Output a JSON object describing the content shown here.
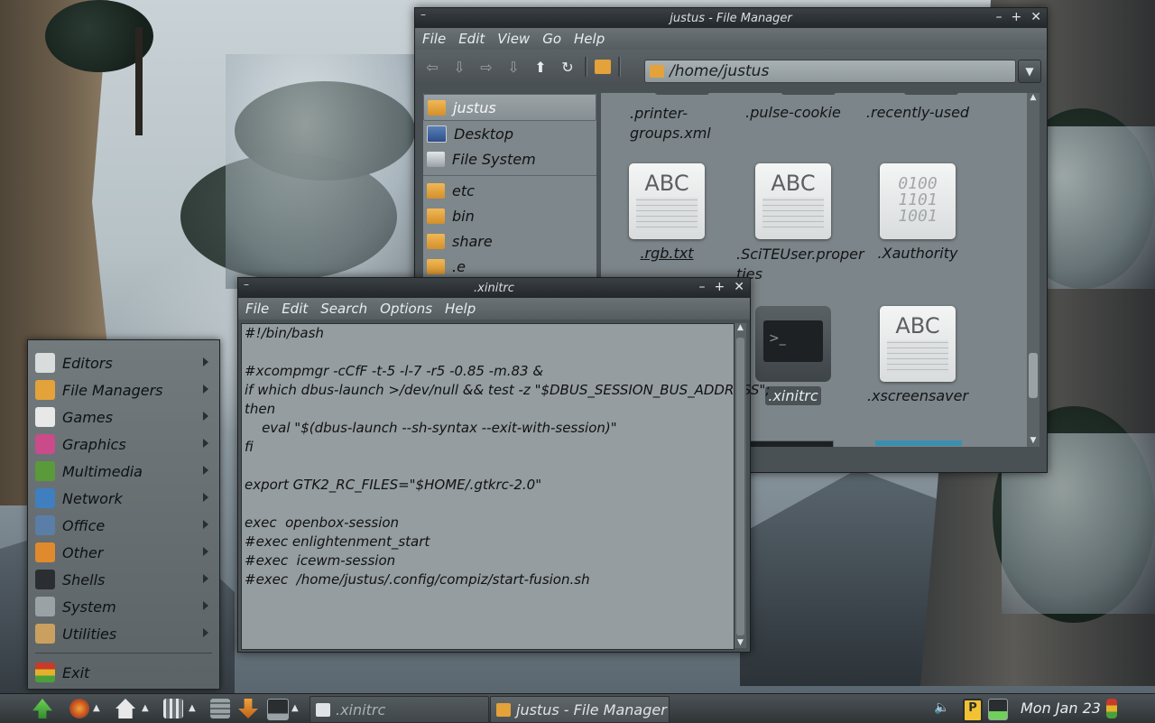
{
  "file_manager": {
    "title": "justus - File Manager",
    "menu": [
      "File",
      "Edit",
      "View",
      "Go",
      "Help"
    ],
    "path": "/home/justus",
    "sidebar": [
      {
        "label": "justus",
        "icon": "home-folder-icon",
        "selected": true
      },
      {
        "label": "Desktop",
        "icon": "desktop-icon"
      },
      {
        "label": "File System",
        "icon": "drive-icon"
      },
      {
        "label": "etc",
        "icon": "folder-icon"
      },
      {
        "label": "bin",
        "icon": "folder-icon"
      },
      {
        "label": "share",
        "icon": "folder-icon"
      },
      {
        "label": ".e",
        "icon": "folder-icon"
      }
    ],
    "files": [
      {
        "name": ".printer-groups.xml",
        "line1": ".printer-",
        "line2": "groups.xml"
      },
      {
        "name": ".pulse-cookie"
      },
      {
        "name": ".recently-used"
      },
      {
        "name": ".rgb.txt",
        "thumb": "ABC"
      },
      {
        "name": ".SciTEUser.properties",
        "line1": ".SciTEUser.proper",
        "line2": "ties",
        "thumb": "ABC"
      },
      {
        "name": ".Xauthority",
        "thumb": [
          "0100",
          "1101",
          "1001"
        ]
      },
      {
        "name": ".xinitrc",
        "thumb": ">_"
      },
      {
        "name": ".xscreensaver",
        "thumb": "ABC"
      }
    ]
  },
  "editor": {
    "title": ".xinitrc",
    "menu": [
      "File",
      "Edit",
      "Search",
      "Options",
      "Help"
    ],
    "content": "#!/bin/bash\n\n#xcompmgr -cCfF -t-5 -l-7 -r5 -0.85 -m.83 &\nif which dbus-launch >/dev/null && test -z \"$DBUS_SESSION_BUS_ADDRESS\";\nthen\n    eval \"$(dbus-launch --sh-syntax --exit-with-session)\"\nfi\n\nexport GTK2_RC_FILES=\"$HOME/.gtkrc-2.0\"\n\nexec  openbox-session\n#exec enlightenment_start\n#exec  icewm-session\n#exec  /home/justus/.config/compiz/start-fusion.sh"
  },
  "app_menu": {
    "items": [
      {
        "label": "Editors",
        "icon": "editors-icon",
        "color": "#d9dcdd"
      },
      {
        "label": "File Managers",
        "icon": "folder-icon",
        "color": "#e3a23a"
      },
      {
        "label": "Games",
        "icon": "dice-icon",
        "color": "#e8e8e8"
      },
      {
        "label": "Graphics",
        "icon": "color-wheel-icon",
        "color": "#c94b8a"
      },
      {
        "label": "Multimedia",
        "icon": "film-icon",
        "color": "#5a9a3a"
      },
      {
        "label": "Network",
        "icon": "globe-icon",
        "color": "#3f7fc0"
      },
      {
        "label": "Office",
        "icon": "chart-icon",
        "color": "#5b7ea8"
      },
      {
        "label": "Other",
        "icon": "grid-icon",
        "color": "#e08a2e"
      },
      {
        "label": "Shells",
        "icon": "terminal-icon",
        "color": "#2a2e30"
      },
      {
        "label": "System",
        "icon": "system-icon",
        "color": "#9aa2a6"
      },
      {
        "label": "Utilities",
        "icon": "toolbox-icon",
        "color": "#c9a060"
      }
    ],
    "exit": "Exit"
  },
  "taskbar": {
    "tasks": [
      {
        "label": ".xinitrc",
        "icon": "editor-icon"
      },
      {
        "label": "justus - File Manager",
        "icon": "folder-icon"
      }
    ],
    "clock": "Mon Jan 23"
  }
}
